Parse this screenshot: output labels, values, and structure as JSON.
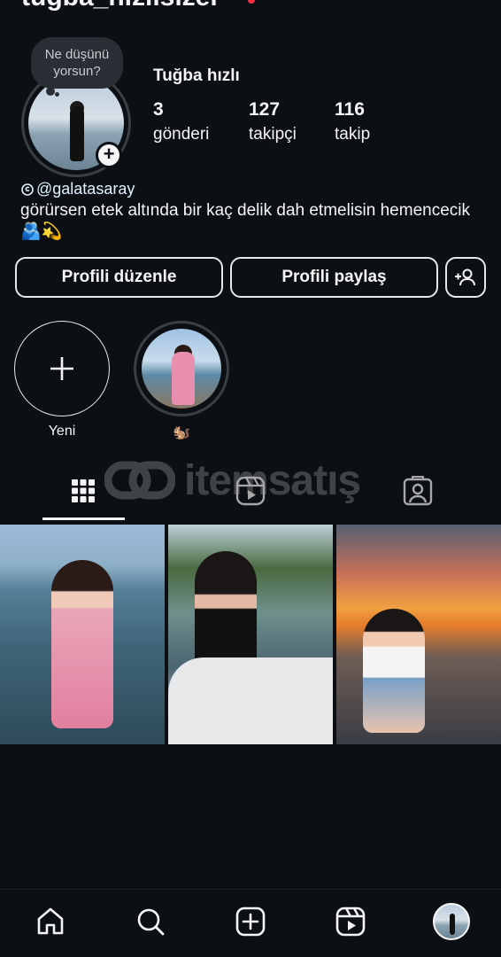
{
  "header": {
    "username": "tuğba_hızlısızel"
  },
  "profile": {
    "note": "Ne düşünü yorsun?",
    "full_name": "Tuğba hızlı",
    "stats": [
      {
        "value": "3",
        "label": "gönderi"
      },
      {
        "value": "127",
        "label": "takipçi"
      },
      {
        "value": "116",
        "label": "takip"
      }
    ],
    "bio_link": "@galatasaray",
    "bio_text": "görürsen etek altında bir kaç delik dah etmelisin hemencecik🫂💫"
  },
  "actions": {
    "edit_label": "Profili düzenle",
    "share_label": "Profili paylaş",
    "add_user_icon": "add-user-icon"
  },
  "highlights": [
    {
      "label": "Yeni"
    },
    {
      "label": "🐿️"
    }
  ],
  "watermark": {
    "text": "itemsatış"
  },
  "tabs": [
    {
      "icon": "grid-icon",
      "active": true
    },
    {
      "icon": "reels-icon",
      "active": false
    },
    {
      "icon": "tagged-icon",
      "active": false
    }
  ],
  "posts": [
    {
      "id": "post-1"
    },
    {
      "id": "post-2"
    },
    {
      "id": "post-3"
    }
  ],
  "bottom_nav": [
    "home-icon",
    "search-icon",
    "create-icon",
    "reels-icon",
    "profile-avatar"
  ],
  "colors": {
    "background": "#0c1014",
    "text": "#f5f5f5",
    "link": "#e0f1ff",
    "notification": "#ff3040"
  }
}
